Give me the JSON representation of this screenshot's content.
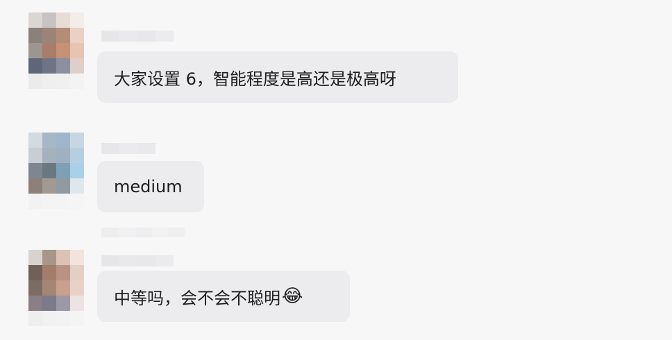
{
  "messages": [
    {
      "text": "大家设置 6，智能程度是高还是极高呀",
      "emoji": ""
    },
    {
      "text": "medium",
      "emoji": ""
    },
    {
      "text": "中等吗，会不会不聪明",
      "emoji": "😂"
    }
  ]
}
